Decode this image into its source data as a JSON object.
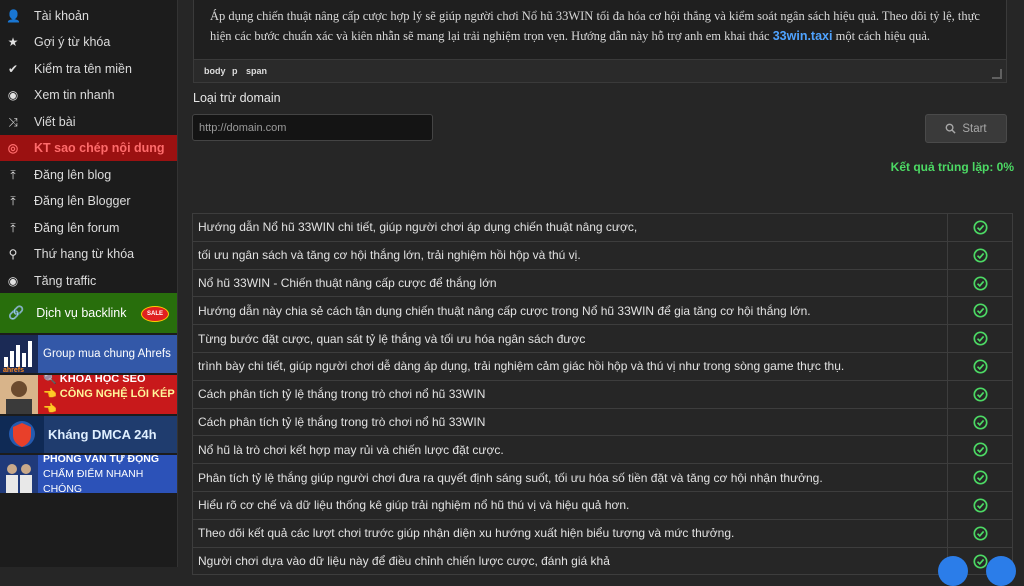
{
  "sidebar": {
    "items": [
      {
        "label": "Tài khoản",
        "icon": "user-icon"
      },
      {
        "label": "Gợi ý từ khóa",
        "icon": "star-icon"
      },
      {
        "label": "Kiểm tra tên miền",
        "icon": "check-icon"
      },
      {
        "label": "Xem tin nhanh",
        "icon": "eye-icon"
      },
      {
        "label": "Viết bài",
        "icon": "shuffle-icon"
      },
      {
        "label": "KT sao chép nội dung",
        "icon": "target-icon",
        "active": true
      },
      {
        "label": "Đăng lên blog",
        "icon": "upload-icon"
      },
      {
        "label": "Đăng lên Blogger",
        "icon": "upload-icon"
      },
      {
        "label": "Đăng lên forum",
        "icon": "upload-icon"
      },
      {
        "label": "Thứ hạng từ khóa",
        "icon": "search-icon"
      },
      {
        "label": "Tăng traffic",
        "icon": "eye-icon"
      }
    ],
    "backlink": {
      "label": "Dịch vụ backlink",
      "badge": "SALE"
    },
    "banners": {
      "ahrefs": {
        "logo": "ahrefs",
        "text": "Group mua chung Ahrefs"
      },
      "seo": {
        "line1": "🔍 KHÓA HỌC SEO",
        "line2": "👈 CÔNG NGHỆ LÕI KÉP 👈"
      },
      "dmca": {
        "text": "Kháng DMCA 24h"
      },
      "interview": {
        "line1": "PHỎNG VẤN TỰ ĐỘNG",
        "line2": "CHẤM ĐIỂM NHANH CHÓNG"
      }
    }
  },
  "editor": {
    "text_before": "Áp dụng chiến thuật nâng cấp cược hợp lý sẽ giúp người chơi Nổ hũ 33WIN tối đa hóa cơ hội thắng và kiểm soát ngân sách hiệu quả. Theo dõi tỷ lệ, thực hiện các bước chuẩn xác và kiên nhẫn sẽ mang lại trải nghiệm trọn vẹn. Hướng dẫn này hỗ trợ anh em khai thác ",
    "link_text": "33win.taxi",
    "text_after": " một cách hiệu quả.",
    "path": [
      "body",
      "p",
      "span"
    ]
  },
  "domain": {
    "label": "Loại trừ domain",
    "placeholder": "http://domain.com",
    "start_label": "Start"
  },
  "result_text": "Kết quả trùng lặp: 0%",
  "rows": [
    "Hướng dẫn Nổ hũ 33WIN chi tiết, giúp người chơi áp dụng chiến thuật nâng cược,",
    "tối ưu ngân sách và tăng cơ hội thắng lớn, trải nghiệm hồi hộp và thú vị.",
    "Nổ hũ 33WIN - Chiến thuật nâng cấp cược để thắng lớn",
    "Hướng dẫn này chia sẻ cách tận dụng chiến thuật nâng cấp cược trong Nổ hũ 33WIN để gia tăng cơ hội thắng lớn.",
    "Từng bước đặt cược, quan sát tỷ lệ thắng và tối ưu hóa ngân sách được",
    "trình bày chi tiết, giúp người chơi dễ dàng áp dụng, trải nghiệm cảm giác hồi hộp và thú vị như trong sòng game thực thụ.",
    "Cách phân tích tỷ lệ thắng trong trò chơi nổ hũ 33WIN",
    "Cách phân tích tỷ lệ thắng trong trò chơi nổ hũ 33WIN",
    "Nổ hũ là trò chơi kết hợp may rủi và chiến lược đặt cược.",
    "Phân tích tỷ lệ thắng giúp người chơi đưa ra quyết định sáng suốt, tối ưu hóa số tiền đặt và tăng cơ hội nhận thưởng.",
    "Hiểu rõ cơ chế và dữ liệu thống kê giúp trải nghiệm nổ hũ thú vị và hiệu quả hơn.",
    "Theo dõi kết quả các lượt chơi trước giúp nhận diện xu hướng xuất hiện biểu tượng và mức thưởng.",
    "Người chơi dựa vào dữ liệu này để điều chỉnh chiến lược cược, đánh giá khả"
  ],
  "colors": {
    "accent_green": "#4cd964",
    "active_red": "#9b1111",
    "link_blue": "#4fa3ff"
  }
}
